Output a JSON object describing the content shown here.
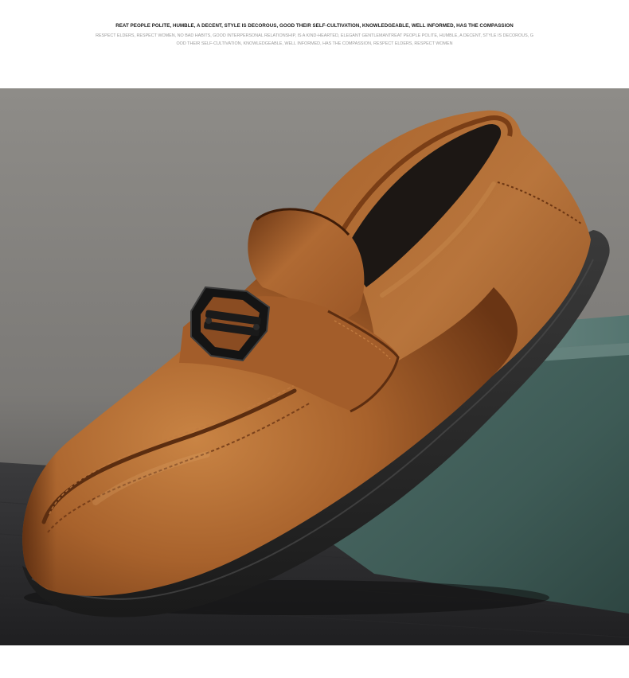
{
  "header": {
    "headline": "REAT PEOPLE POLITE, HUMBLE, A DECENT, STYLE IS DECOROUS, GOOD THEIR SELF-CULTIVATION, KNOWLEDGEABLE, WELL INFORMED, HAS THE COMPASSION",
    "subline_1": "RESPECT ELDERS, RESPECT WOMEN, NO BAD HABITS, GOOD INTERPERSONAL RELATIONSHIP, IS A KIND-HEARTED, ELEGANT GENTLEMANTREAT PEOPLE POLITE, HUMBLE, A DECENT, STYLE IS DECOROUS, G",
    "subline_2": "OOD THEIR SELF-CULTIVATION, KNOWLEDGEABLE, WELL INFORMED, HAS THE COMPASSION, RESPECT ELDERS, RESPECT WOMEN"
  },
  "photo": {
    "subject": "brown-leather-loafer",
    "colors": {
      "background_top": "#8f8d89",
      "background_mid": "#6f6d6a",
      "floor": "#2c2c2e",
      "block": "#3f5d58",
      "leather_light": "#b8723a",
      "leather_mid": "#9c5a28",
      "leather_dark": "#5e3012",
      "sole": "#2a2a2a",
      "buckle": "#1c1c1c"
    }
  }
}
